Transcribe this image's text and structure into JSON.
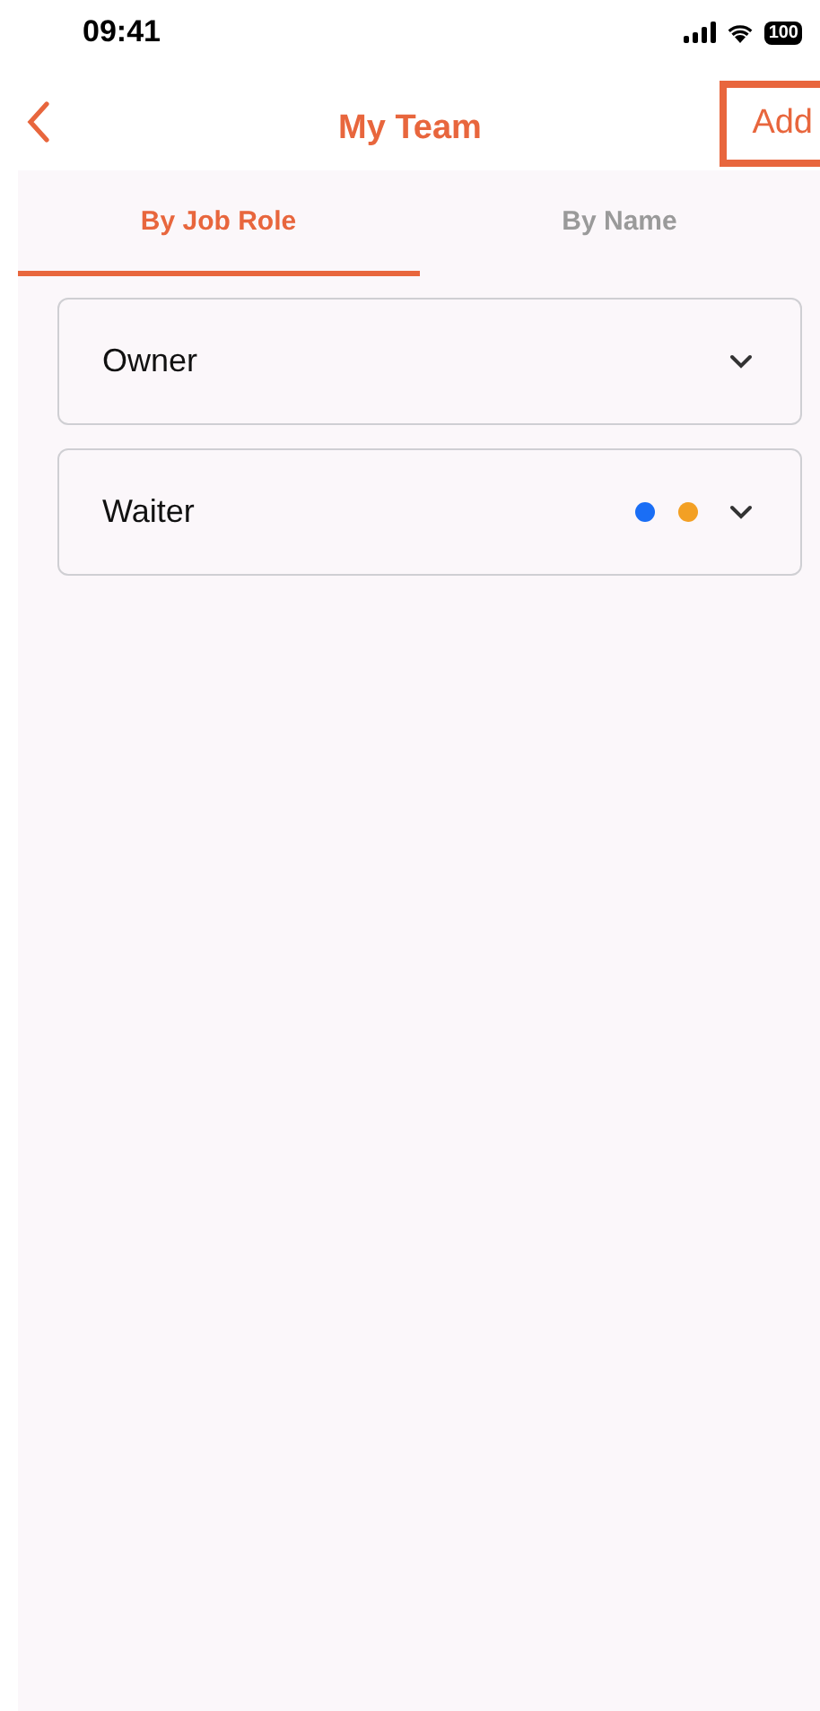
{
  "status_bar": {
    "time": "09:41",
    "battery": "100"
  },
  "nav": {
    "title": "My Team",
    "action": {
      "label": "Add",
      "highlighted": true
    }
  },
  "tabs": [
    {
      "label": "By Job Role",
      "selected": true
    },
    {
      "label": "By Name",
      "selected": false
    }
  ],
  "roles": [
    {
      "name": "Owner",
      "expanded": false
    },
    {
      "name": "Waiter",
      "expanded": false,
      "dots": [
        {
          "color": "#1a6ef5"
        },
        {
          "color": "#f3a024"
        }
      ]
    }
  ]
}
